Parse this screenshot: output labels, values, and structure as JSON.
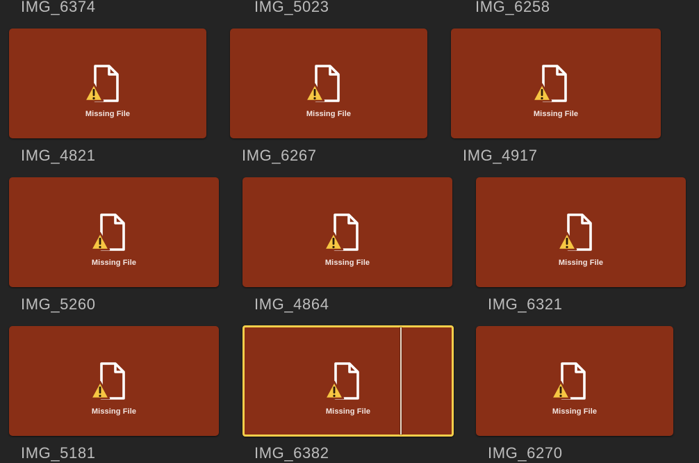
{
  "theme": {
    "background": "#242424",
    "tile_fill": "#892f16",
    "label_color": "#bdbdbd",
    "selection_color": "#f7cf4a",
    "warning_color": "#f6c643"
  },
  "missing_label": "Missing File",
  "icons": {
    "file": "file-outline-icon",
    "warning": "warning-triangle-icon"
  },
  "top_labels": [
    "IMG_6374",
    "IMG_5023",
    "IMG_6258"
  ],
  "rows": [
    {
      "clips": [
        {
          "name": "IMG_4821"
        },
        {
          "name": "IMG_6267"
        },
        {
          "name": "IMG_4917"
        }
      ]
    },
    {
      "clips": [
        {
          "name": "IMG_5260"
        },
        {
          "name": "IMG_4864"
        },
        {
          "name": "IMG_6321"
        }
      ]
    },
    {
      "clips": [
        {
          "name": "IMG_5181"
        },
        {
          "name": "IMG_6382",
          "selected": true
        },
        {
          "name": "IMG_6270"
        }
      ]
    }
  ]
}
